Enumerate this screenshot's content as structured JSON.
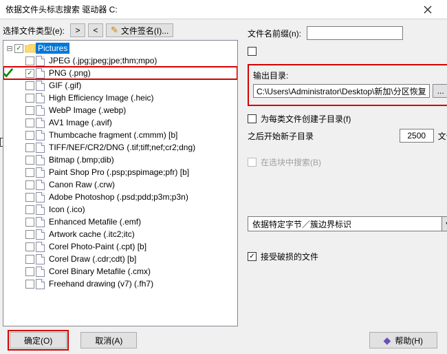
{
  "title": "依据文件头标志搜索 驱动器 C:",
  "toolbar": {
    "select_type_label": "选择文件类型(e):",
    "prev": ">",
    "next": "<",
    "signature_label": "文件签名(I)..."
  },
  "tree": {
    "root": {
      "label": "Pictures",
      "expanded": true,
      "checked": "partial",
      "selected": true
    },
    "items": [
      {
        "label": "JPEG (.jpg;jpeg;jpe;thm;mpo)",
        "checked": false
      },
      {
        "label": "PNG (.png)",
        "checked": true,
        "highlight": true,
        "greenmark": true
      },
      {
        "label": "GIF (.gif)",
        "checked": false
      },
      {
        "label": "High Efficiency Image (.heic)",
        "checked": false
      },
      {
        "label": "WebP Image (.webp)",
        "checked": false
      },
      {
        "label": "AV1 Image (.avif)",
        "checked": false
      },
      {
        "label": "Thumbcache fragment (.cmmm) [b]",
        "checked": false
      },
      {
        "label": "TIFF/NEF/CR2/DNG (.tif;tiff;nef;cr2;dng)",
        "checked": false
      },
      {
        "label": "Bitmap (.bmp;dib)",
        "checked": false
      },
      {
        "label": "Paint Shop Pro (.psp;pspimage;pfr) [b]",
        "checked": false
      },
      {
        "label": "Canon Raw (.crw)",
        "checked": false
      },
      {
        "label": "Adobe Photoshop (.psd;pdd;p3m;p3n)",
        "checked": false
      },
      {
        "label": "Icon (.ico)",
        "checked": false
      },
      {
        "label": "Enhanced Metafile (.emf)",
        "checked": false
      },
      {
        "label": "Artwork cache (.itc2;itc)",
        "checked": false
      },
      {
        "label": "Corel Photo-Paint (.cpt) [b]",
        "checked": false
      },
      {
        "label": "Corel Draw (.cdr;cdt) [b]",
        "checked": false
      },
      {
        "label": "Corel Binary Metafile (.cmx)",
        "checked": false
      },
      {
        "label": "Freehand drawing (v7) (.fh7)",
        "checked": false
      }
    ]
  },
  "right": {
    "prefix_label": "文件名前缀(n):",
    "prefix_value": "",
    "outdir_label": "输出目录:",
    "outdir_value": "C:\\Users\\Administrator\\Desktop\\新加\\分区恢复",
    "browse": "...",
    "create_subdir_label": "为每类文件创建子目录(f)",
    "after_label_a": "之后开始新子目录",
    "after_value": "2500",
    "after_label_b": "文件",
    "search_sel_label": "在选块中搜索(B)",
    "combo_value": "依据特定字节／簇边界标识",
    "accept_damaged_label": "接受破损的文件"
  },
  "buttons": {
    "ok": "确定(O)",
    "cancel": "取消(A)",
    "help": "帮助(H)"
  }
}
